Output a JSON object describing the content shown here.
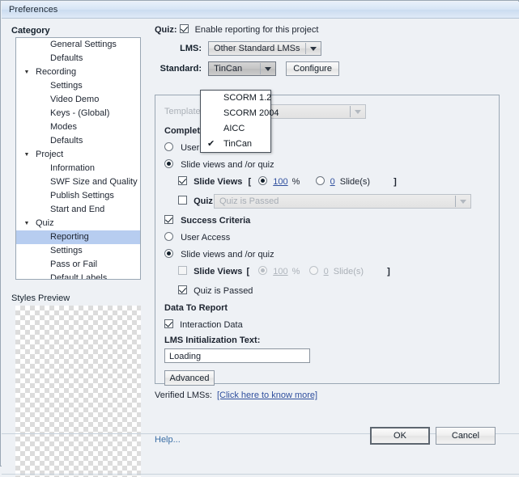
{
  "window": {
    "title": "Preferences"
  },
  "sidebar": {
    "heading": "Category",
    "items": [
      {
        "label": "General Settings",
        "depth": 2,
        "arrow": "",
        "selected": false
      },
      {
        "label": "Defaults",
        "depth": 2,
        "arrow": "",
        "selected": false
      },
      {
        "label": "Recording",
        "depth": 1,
        "arrow": "▼",
        "selected": false
      },
      {
        "label": "Settings",
        "depth": 2,
        "arrow": "",
        "selected": false
      },
      {
        "label": "Video Demo",
        "depth": 2,
        "arrow": "",
        "selected": false
      },
      {
        "label": "Keys - (Global)",
        "depth": 2,
        "arrow": "",
        "selected": false
      },
      {
        "label": "Modes",
        "depth": 2,
        "arrow": "",
        "selected": false
      },
      {
        "label": "Defaults",
        "depth": 2,
        "arrow": "",
        "selected": false
      },
      {
        "label": "Project",
        "depth": 1,
        "arrow": "▼",
        "selected": false
      },
      {
        "label": "Information",
        "depth": 2,
        "arrow": "",
        "selected": false
      },
      {
        "label": "SWF Size and Quality",
        "depth": 2,
        "arrow": "",
        "selected": false
      },
      {
        "label": "Publish Settings",
        "depth": 2,
        "arrow": "",
        "selected": false
      },
      {
        "label": "Start and End",
        "depth": 2,
        "arrow": "",
        "selected": false
      },
      {
        "label": "Quiz",
        "depth": 1,
        "arrow": "▼",
        "selected": false
      },
      {
        "label": "Reporting",
        "depth": 2,
        "arrow": "",
        "selected": true
      },
      {
        "label": "Settings",
        "depth": 2,
        "arrow": "",
        "selected": false
      },
      {
        "label": "Pass or Fail",
        "depth": 2,
        "arrow": "",
        "selected": false
      },
      {
        "label": "Default Labels",
        "depth": 2,
        "arrow": "",
        "selected": false
      }
    ],
    "styles_preview_label": "Styles Preview"
  },
  "main": {
    "quiz_label": "Quiz:",
    "enable_reporting_label": "Enable reporting for this project",
    "enable_reporting_checked": true,
    "lms_label": "LMS:",
    "lms_value": "Other Standard LMSs",
    "standard_label": "Standard:",
    "standard_value": "TinCan",
    "configure_label": "Configure",
    "template_label": "Template:",
    "template_value": "",
    "standard_menu": {
      "options": [
        "SCORM 1.2",
        "SCORM 2004",
        "AICC",
        "TinCan"
      ],
      "selected": "TinCan",
      "check_glyph": "✔"
    },
    "completion": {
      "heading": "Completion Criteria",
      "user_access_label": "User Access",
      "user_access_selected": false,
      "slide_or_quiz_label": "Slide views and /or quiz",
      "slide_or_quiz_selected": true,
      "slide_views_label": "Slide Views",
      "slide_views_checked": true,
      "bracket_open": "[",
      "bracket_close": "]",
      "percent_value": "100",
      "percent_unit": "%",
      "percent_selected": true,
      "slides_value": "0",
      "slides_unit": "Slide(s)",
      "slides_selected": false,
      "quiz_label": "Quiz",
      "quiz_checked": false,
      "quiz_combo_value": "Quiz is Passed"
    },
    "success": {
      "heading": "Success Criteria",
      "heading_checked": true,
      "user_access_label": "User Access",
      "user_access_selected": false,
      "slide_or_quiz_label": "Slide views and /or quiz",
      "slide_or_quiz_selected": true,
      "slide_views_label": "Slide Views",
      "slide_views_checked": false,
      "bracket_open": "[",
      "bracket_close": "]",
      "percent_value": "100",
      "percent_unit": "%",
      "percent_selected": true,
      "slides_value": "0",
      "slides_unit": "Slide(s)",
      "slides_selected": false,
      "quiz_passed_label": "Quiz is Passed",
      "quiz_passed_checked": true
    },
    "data_to_report": {
      "heading": "Data To Report",
      "interaction_data_label": "Interaction Data",
      "interaction_data_checked": true
    },
    "lms_init": {
      "label": "LMS Initialization Text:",
      "value": "Loading"
    },
    "advanced_label": "Advanced",
    "verified_label": "Verified LMSs:",
    "verified_link": "[Click here to know more]"
  },
  "footer": {
    "help_label": "Help...",
    "ok_label": "OK",
    "cancel_label": "Cancel"
  }
}
